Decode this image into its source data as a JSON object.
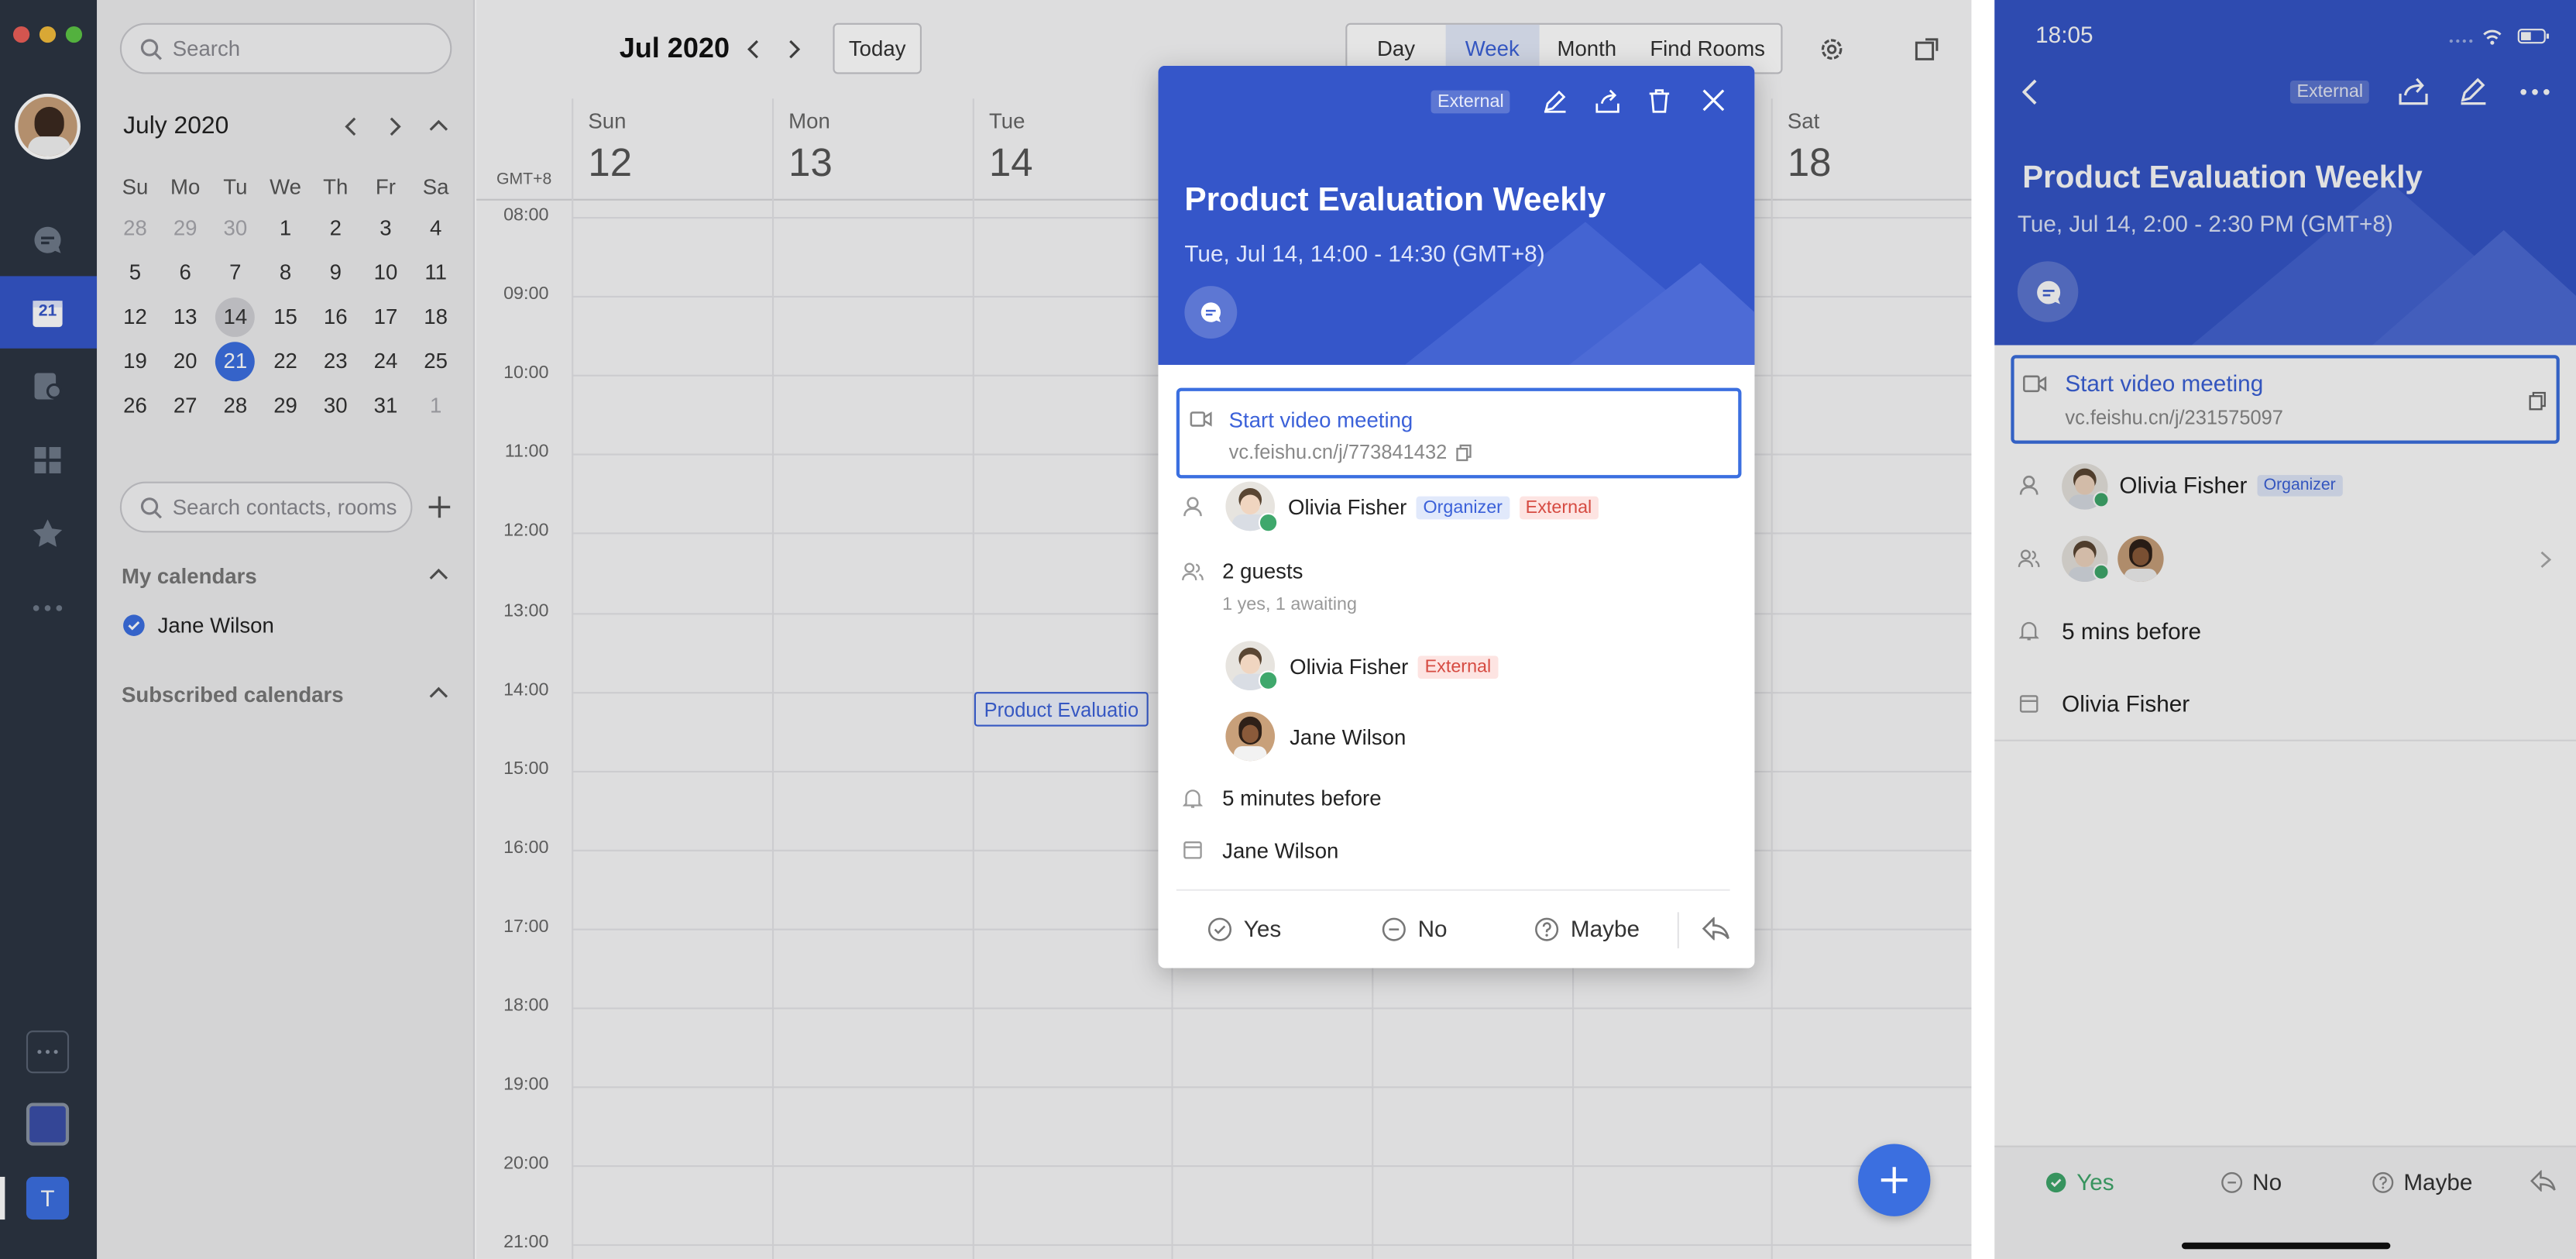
{
  "sidebar": {
    "search_placeholder": "Search",
    "month_label": "July 2020",
    "weekdays": [
      "Su",
      "Mo",
      "Tu",
      "We",
      "Th",
      "Fr",
      "Sa"
    ],
    "weeks": [
      [
        "28",
        "29",
        "30",
        "1",
        "2",
        "3",
        "4"
      ],
      [
        "5",
        "6",
        "7",
        "8",
        "9",
        "10",
        "11"
      ],
      [
        "12",
        "13",
        "14",
        "15",
        "16",
        "17",
        "18"
      ],
      [
        "19",
        "20",
        "21",
        "22",
        "23",
        "24",
        "25"
      ],
      [
        "26",
        "27",
        "28",
        "29",
        "30",
        "31",
        "1"
      ]
    ],
    "contacts_placeholder": "Search contacts, rooms",
    "my_calendars_label": "My calendars",
    "my_calendar_item": "Jane Wilson",
    "subscribed_label": "Subscribed calendars"
  },
  "rail": {
    "calendar_day": "21",
    "workspace_letter": "T"
  },
  "toolbar": {
    "title": "Jul 2020",
    "today_label": "Today",
    "views": [
      "Day",
      "Week",
      "Month",
      "Find Rooms"
    ],
    "active_view": "Week"
  },
  "week": {
    "timezone": "GMT+8",
    "days": [
      {
        "name": "Sun",
        "num": "12"
      },
      {
        "name": "Mon",
        "num": "13"
      },
      {
        "name": "Tue",
        "num": "14"
      },
      {
        "name": "",
        "num": ""
      },
      {
        "name": "",
        "num": ""
      },
      {
        "name": "",
        "num": ""
      },
      {
        "name": "Sat",
        "num": "18"
      }
    ],
    "hours": [
      "08:00",
      "09:00",
      "10:00",
      "11:00",
      "12:00",
      "13:00",
      "14:00",
      "15:00",
      "16:00",
      "17:00",
      "18:00",
      "19:00",
      "20:00",
      "21:00"
    ],
    "event_chip": "Product Evaluatio"
  },
  "popup": {
    "external_badge": "External",
    "title": "Product Evaluation Weekly",
    "time": "Tue, Jul 14, 14:00 - 14:30 (GMT+8)",
    "video_label": "Start video meeting",
    "video_url": "vc.feishu.cn/j/773841432",
    "organizer_name": "Olivia Fisher",
    "organizer_badge": "Organizer",
    "external_badge2": "External",
    "guests_count": "2 guests",
    "guests_status": "1 yes, 1 awaiting",
    "guest1_name": "Olivia Fisher",
    "guest1_badge": "External",
    "guest2_name": "Jane Wilson",
    "reminder": "5 minutes before",
    "calendar": "Jane Wilson",
    "rsvp_yes": "Yes",
    "rsvp_no": "No",
    "rsvp_maybe": "Maybe"
  },
  "phone": {
    "clock": "18:05",
    "external_badge": "External",
    "title": "Product Evaluation Weekly",
    "time": "Tue, Jul 14, 2:00 - 2:30 PM (GMT+8)",
    "video_label": "Start video meeting",
    "video_url": "vc.feishu.cn/j/231575097",
    "organizer_name": "Olivia Fisher",
    "organizer_badge": "Organizer",
    "reminder": "5 mins before",
    "calendar": "Olivia Fisher",
    "rsvp_yes": "Yes",
    "rsvp_no": "No",
    "rsvp_maybe": "Maybe"
  },
  "colors": {
    "accent": "#3556c9",
    "rail": "#2c3542",
    "external": "#d64b42",
    "organizer": "#3b61d9"
  }
}
